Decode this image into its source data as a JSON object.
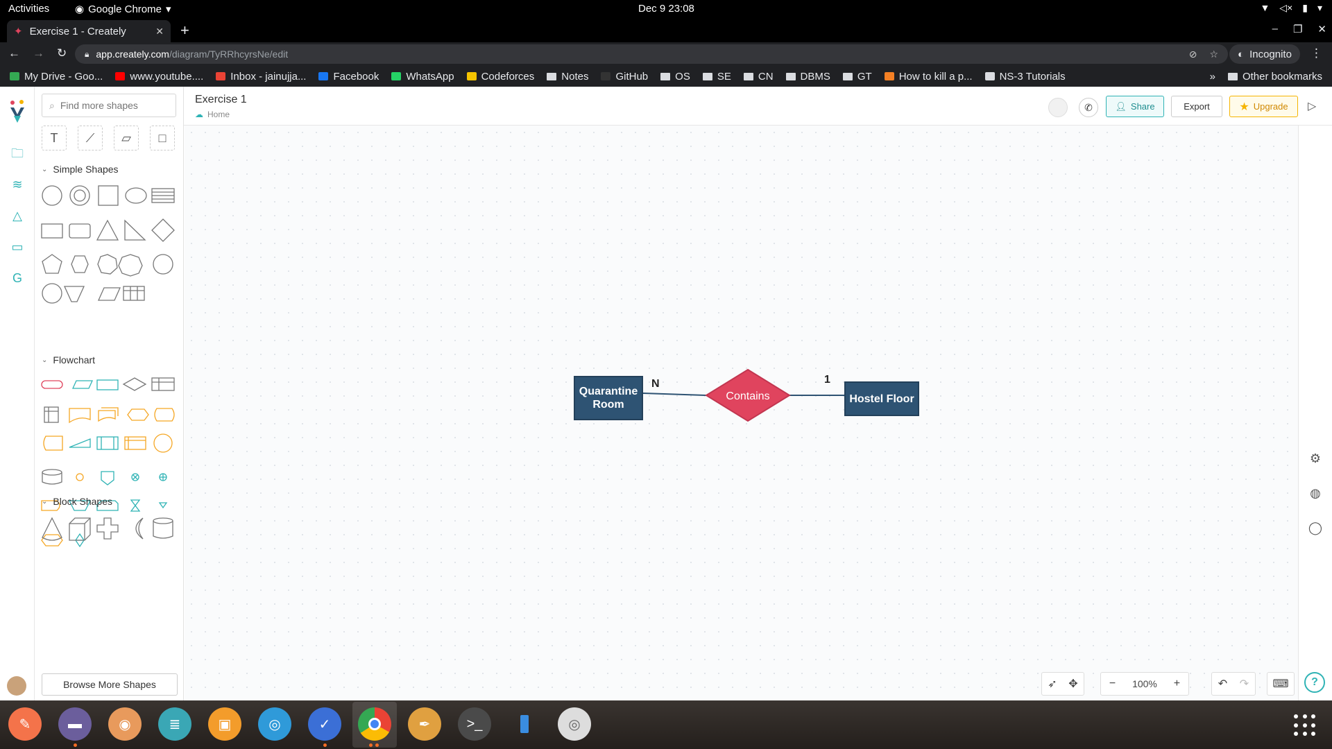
{
  "system_bar": {
    "activities": "Activities",
    "app_name": "Google Chrome",
    "clock": "Dec 9  23:08"
  },
  "browser": {
    "tab_title": "Exercise 1 - Creately",
    "url_host": "app.creately.com",
    "url_path": "/diagram/TyRRhcyrsNe/edit",
    "profile": "Incognito",
    "bookmarks": [
      {
        "label": "My Drive - Goo...",
        "icon": "drive-icon",
        "color": "#34a853"
      },
      {
        "label": "www.youtube....",
        "icon": "youtube-icon",
        "color": "#ff0000"
      },
      {
        "label": "Inbox - jainujja...",
        "icon": "gmail-icon",
        "color": "#ea4335"
      },
      {
        "label": "Facebook",
        "icon": "facebook-icon",
        "color": "#1877f2"
      },
      {
        "label": "WhatsApp",
        "icon": "whatsapp-icon",
        "color": "#25d366"
      },
      {
        "label": "Codeforces",
        "icon": "codeforces-icon",
        "color": "#f5c400"
      },
      {
        "label": "Notes",
        "icon": "folder-icon",
        "color": "#dadce0"
      },
      {
        "label": "GitHub",
        "icon": "github-icon",
        "color": "#333333"
      },
      {
        "label": "OS",
        "icon": "folder-icon",
        "color": "#dadce0"
      },
      {
        "label": "SE",
        "icon": "folder-icon",
        "color": "#dadce0"
      },
      {
        "label": "CN",
        "icon": "folder-icon",
        "color": "#dadce0"
      },
      {
        "label": "DBMS",
        "icon": "folder-icon",
        "color": "#dadce0"
      },
      {
        "label": "GT",
        "icon": "folder-icon",
        "color": "#dadce0"
      },
      {
        "label": "How to kill a p...",
        "icon": "stackoverflow-icon",
        "color": "#f48024"
      },
      {
        "label": "NS-3 Tutorials",
        "icon": "globe-icon",
        "color": "#dadce0"
      }
    ],
    "more": "»",
    "other_bookmarks": "Other bookmarks"
  },
  "creately": {
    "search_placeholder": "Find more shapes",
    "sections": {
      "simple": "Simple Shapes",
      "flowchart": "Flowchart",
      "block": "Block Shapes"
    },
    "browse_more": "Browse More Shapes",
    "doc_title": "Exercise 1",
    "breadcrumb_home": "Home",
    "share": "Share",
    "export": "Export",
    "upgrade": "Upgrade",
    "zoom": "100%",
    "accent_color": "#2fb3b5",
    "entity_color": "#2e5373",
    "relationship_color": "#e0445e"
  },
  "diagram": {
    "entity_left": "Quarantine Room",
    "entity_right": "Hostel Floor",
    "relationship": "Contains",
    "cardinality_left": "N",
    "cardinality_right": "1"
  }
}
